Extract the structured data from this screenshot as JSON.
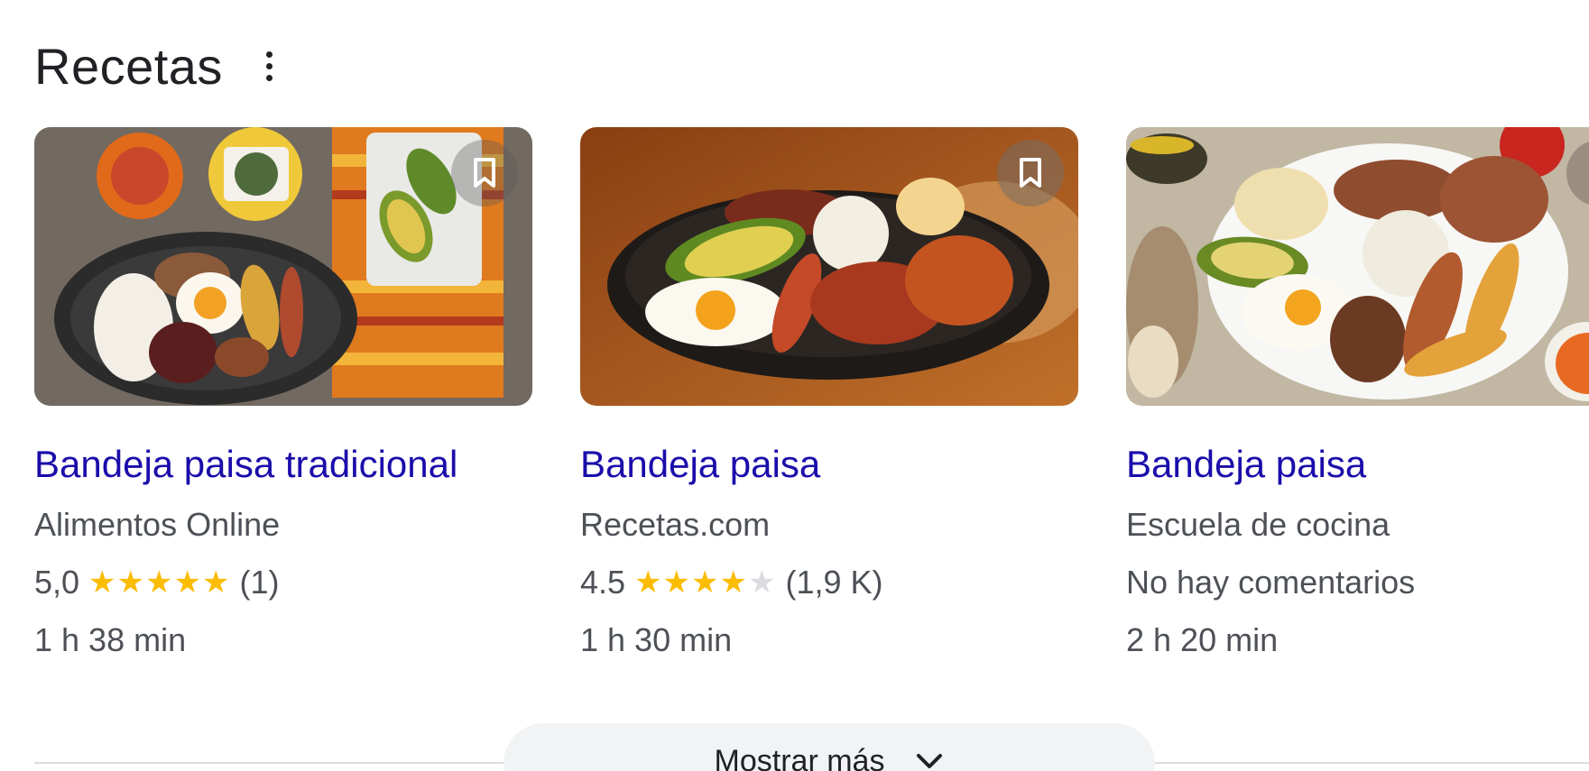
{
  "header": {
    "title": "Recetas",
    "menu_icon": "more-vert-icon"
  },
  "cards": [
    {
      "title": "Bandeja paisa tradicional",
      "source": "Alimentos Online",
      "rating_value": "5,0",
      "rating_stars": 5,
      "rating_count": "(1)",
      "time": "1 h 38 min",
      "bookmark_icon": "bookmark-icon"
    },
    {
      "title": "Bandeja paisa",
      "source": "Recetas.com",
      "rating_value": "4.5",
      "rating_stars": 4,
      "rating_count": "(1,9 K)",
      "time": "1 h 30 min",
      "bookmark_icon": "bookmark-icon"
    },
    {
      "title": "Bandeja paisa",
      "source": "Escuela de cocina",
      "no_reviews": "No hay comentarios",
      "time": "2 h 20 min",
      "bookmark_icon": "bookmark-icon"
    }
  ],
  "show_more": {
    "label": "Mostrar más",
    "icon": "chevron-down-icon"
  },
  "colors": {
    "link": "#1a0dab",
    "star": "#fbbc04",
    "muted_text": "#4d5156"
  }
}
